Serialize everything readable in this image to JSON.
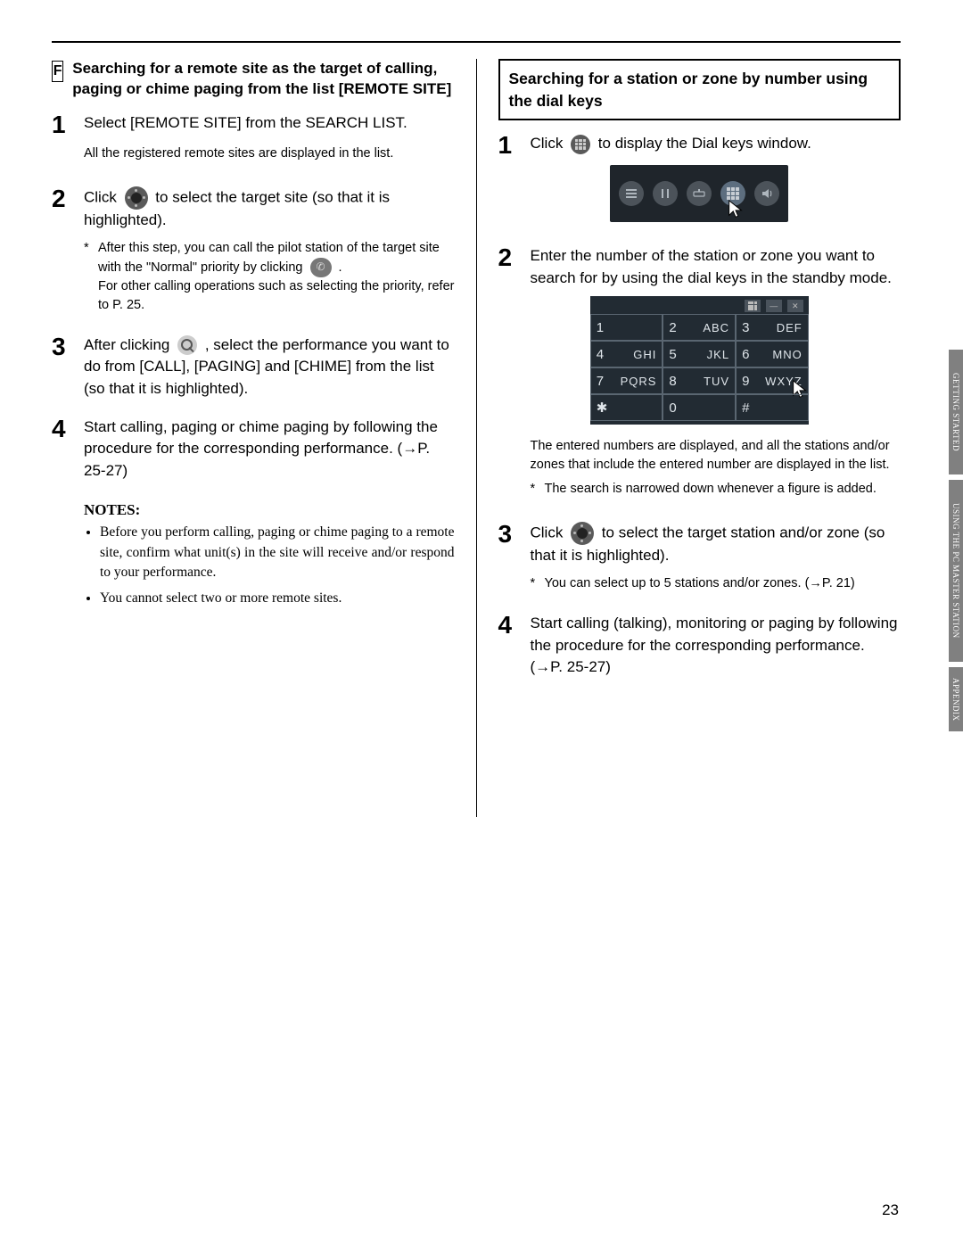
{
  "page_number": "23",
  "side_tabs": [
    "GETTING STARTED",
    "USING THE PC MASTER STATION",
    "APPENDIX"
  ],
  "left": {
    "badge": "F",
    "title": "Searching for a remote site as the target of calling, paging or chime paging from the list [REMOTE SITE]",
    "step1": "Select [REMOTE SITE] from the SEARCH LIST.",
    "step1_note": "All the registered remote sites are displayed in the list.",
    "step2_a": "Click ",
    "step2_b": " to select the target site (so that it is highlighted).",
    "step2_star_a": "After this step, you can call the pilot station of the target site with the \"Normal\" priority by clicking ",
    "step2_star_b": ".",
    "step2_star_c": "For other calling operations such as selecting the priority, refer to P. 25.",
    "step3_a": "After clicking ",
    "step3_b": ", select the performance you want to do from [CALL], [PAGING] and [CHIME] from the list (so that it is highlighted).",
    "step4": "Start calling, paging or chime paging by following the procedure for the corresponding performance. (→P. 25-27)",
    "notes_hd": "NOTES:",
    "note1": "Before you perform calling, paging or chime paging to a remote site, confirm what unit(s) in the site will receive and/or respond to your performance.",
    "note2": "You cannot select two or more remote sites."
  },
  "right": {
    "box_title": "Searching for a station or zone by number using the dial keys",
    "step1_a": "Click ",
    "step1_b": " to display the Dial keys window.",
    "step2": "Enter the number of the station or zone you want to search for by using the dial keys in the standby mode.",
    "step2_note": "The entered numbers are displayed, and all the stations and/or zones that include the entered number are displayed in the list.",
    "step2_star": "The search is narrowed down whenever a figure is added.",
    "step3_a": "Click ",
    "step3_b": " to select the target station and/or zone (so that it is highlighted).",
    "step3_star": "You can select up to 5 stations and/or zones. (→P. 21)",
    "step4": "Start calling (talking), monitoring or paging by following the procedure for the corresponding performance. (→P. 25-27)",
    "keypad": [
      {
        "n": "1",
        "l": ""
      },
      {
        "n": "2",
        "l": "ABC"
      },
      {
        "n": "3",
        "l": "DEF"
      },
      {
        "n": "4",
        "l": "GHI"
      },
      {
        "n": "5",
        "l": "JKL"
      },
      {
        "n": "6",
        "l": "MNO"
      },
      {
        "n": "7",
        "l": "PQRS"
      },
      {
        "n": "8",
        "l": "TUV"
      },
      {
        "n": "9",
        "l": "WXYZ"
      },
      {
        "n": "✱",
        "l": ""
      },
      {
        "n": "0",
        "l": ""
      },
      {
        "n": "#",
        "l": ""
      }
    ],
    "topbar_close": "✕",
    "topbar_min": "—"
  }
}
